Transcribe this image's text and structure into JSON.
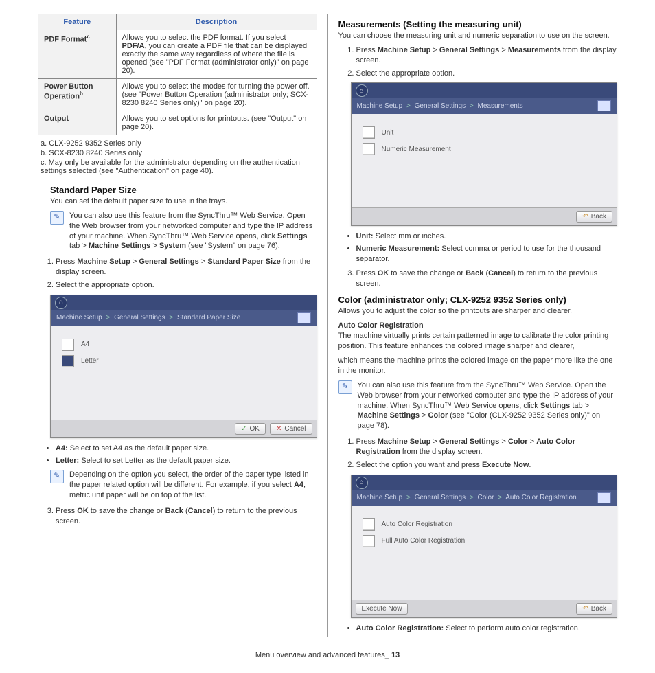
{
  "table": {
    "head_feature": "Feature",
    "head_desc": "Description",
    "r1f_html": "PDF Format<span class='sup'>c</span>",
    "r1d_html": "Allows you to select the PDF format. If you select <b>PDF/A</b>, you can create a PDF file that can be displayed exactly the same way regardless of where the file is opened (see \"PDF Format (administrator only)\" on page 20).",
    "r2f_html": "Power Button Operation<span class='sup'>b</span>",
    "r2d": "Allows you to select the modes for turning the power off. (see \"Power Button Operation (administrator only; SCX-8230 8240 Series only)\" on page 20).",
    "r3f": "Output",
    "r3d": "Allows you to set options for printouts. (see \"Output\" on page 20)."
  },
  "fn": {
    "a": "a. CLX-9252 9352 Series only",
    "b": "b. SCX-8230 8240 Series only",
    "c": "c. May only be available for the administrator depending on the authentication settings selected (see \"Authentication\" on page 40)."
  },
  "sps": {
    "title": "Standard Paper Size",
    "intro": "You can set the default paper size to use in the trays.",
    "note_html": "You can also use this feature from the SyncThru™ Web Service. Open the Web browser from your networked computer and type the IP address of your machine. When SyncThru™ Web Service opens, click <b>Settings</b> tab > <b>Machine Settings</b> > <b>System</b> (see \"System\" on page 76).",
    "step1_html": "Press <b>Machine Setup</b> > <b>General Settings</b> > <b>Standard Paper Size</b> from the display screen.",
    "step2": "Select the appropriate option.",
    "crumb_html": "Machine Setup <span class='sep'>></span> General Settings <span class='sep'>></span> Standard Paper Size",
    "opt_a4": "A4",
    "opt_letter": "Letter",
    "btn_ok": "OK",
    "btn_cancel": "Cancel",
    "b1_html": "<b>A4:</b>  Select to set A4 as the default paper size.",
    "b2_html": "<b>Letter:</b>  Select to set Letter as the default paper size.",
    "note2_html": "Depending on the option you select, the order of the paper type listed in the paper related option will be different. For example, if you select <b>A4</b>, metric unit paper will be on top of the list.",
    "step3_html": "Press <b>OK</b> to save the change or <b>Back</b> (<b>Cancel</b>) to return to the previous screen."
  },
  "meas": {
    "title": "Measurements (Setting the measuring unit)",
    "intro": "You can choose the measuring unit and numeric separation to use on the screen.",
    "step1_html": "Press <b>Machine Setup</b> > <b>General Settings</b> > <b>Measurements</b> from the display screen.",
    "step2": "Select the appropriate option.",
    "crumb_html": "Machine Setup <span class='sep'>></span> General Settings <span class='sep'>></span> Measurements",
    "opt_unit": "Unit",
    "opt_num": "Numeric Measurement",
    "btn_back": "Back",
    "b1_html": "<b>Unit:</b>  Select mm or inches.",
    "b2_html": "<b>Numeric Measurement:</b>  Select comma or period to use for the thousand separator.",
    "step3_html": "Press <b>OK</b> to save the change or <b>Back</b> (<b>Cancel</b>) to return to the previous screen."
  },
  "color": {
    "title": "Color (administrator only; CLX-9252 9352 Series only)",
    "intro": "Allows you to adjust the color so the printouts are sharper and clearer.",
    "sub": "Auto Color Registration",
    "p1": "The machine virtually prints certain patterned image to calibrate the color printing position. This feature enhances the colored image sharper and clearer,",
    "p2": "which means the machine prints the colored image on the paper more like the one in the monitor.",
    "note_html": "You can also use this feature from the SyncThru™ Web Service. Open the Web browser from your networked computer and type the IP address of your machine. When SyncThru™ Web Service opens, click <b>Settings</b> tab > <b>Machine Settings</b> > <b>Color</b> (see \"Color (CLX-9252 9352 Series only)\" on page 78).",
    "step1_html": "Press <b>Machine Setup</b> > <b>General Settings</b> > <b>Color</b> > <b>Auto Color Registration</b> from the display screen.",
    "step2_html": "Select the option you want and press <b>Execute Now</b>.",
    "crumb_html": "Machine Setup <span class='sep'>></span> General Settings <span class='sep'>></span> Color <span class='sep'>></span> Auto Color Registration",
    "opt_acr": "Auto Color Registration",
    "opt_facr": "Full Auto Color Registration",
    "btn_exec": "Execute Now",
    "b1_html": "<b>Auto Color Registration:</b>  Select to perform auto color registration."
  },
  "footer_html": "Menu overview and advanced features<b>_ 13</b>"
}
